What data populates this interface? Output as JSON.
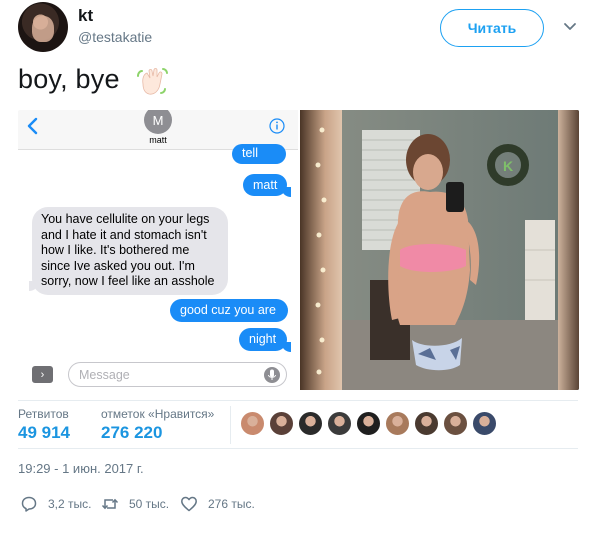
{
  "header": {
    "display_name": "kt",
    "handle": "@testakatie",
    "follow_label": "Читать",
    "avatar_icon": "profile-photo",
    "caret_icon": "chevron-down-icon"
  },
  "tweet": {
    "text": "boy, bye",
    "emoji": "waving-hand-icon"
  },
  "messages_screenshot": {
    "contact_initial": "M",
    "contact_name": "matt",
    "bubbles": [
      {
        "from": "me",
        "text": "tell me"
      },
      {
        "from": "me",
        "text": "matt"
      },
      {
        "from": "them",
        "text": "You have cellulite on your legs and I hate it and stomach isn't how I like. It's bothered me since Ive asked you out. I'm sorry,  now I feel like an asshole"
      },
      {
        "from": "me",
        "text": "good cuz you are"
      },
      {
        "from": "me",
        "text": "night"
      }
    ],
    "input_placeholder": "Message",
    "colors": {
      "sent": "#1a8cf7",
      "received": "#e5e5ea"
    }
  },
  "photo": {
    "description_icon": "mirror-selfie-photo"
  },
  "stats": {
    "retweets_label": "Ретвитов",
    "retweets_value": "49 914",
    "likes_label": "отметок «Нравится»",
    "likes_value": "276 220"
  },
  "likers": [
    {
      "color": "#c98a6e"
    },
    {
      "color": "#5a4038"
    },
    {
      "color": "#2a2a2a"
    },
    {
      "color": "#3b3b3b"
    },
    {
      "color": "#1f1f1f"
    },
    {
      "color": "#a87a5c"
    },
    {
      "color": "#4a3a30"
    },
    {
      "color": "#6b5040"
    },
    {
      "color": "#3a4a6a"
    }
  ],
  "timestamp": "19:29 - 1 июн. 2017 г.",
  "actions": {
    "replies": "3,2 тыс.",
    "retweets": "50 тыс.",
    "likes": "276 тыс."
  },
  "colors": {
    "accent": "#1da1f2",
    "stat_blue": "#1b95e0",
    "muted": "#657786"
  }
}
